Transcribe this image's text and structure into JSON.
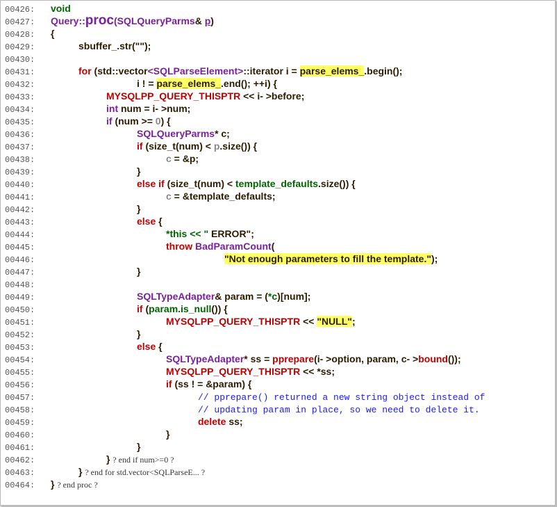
{
  "colors": {
    "keyword": "#006400",
    "type": "#7a1f9e",
    "macro": "#c00000",
    "string": "#000000",
    "comment": "#1a1aff",
    "plain": "#2b1b00",
    "number": "#888888",
    "highlight": "#ffff66"
  },
  "lines": [
    {
      "no": "00426:",
      "indent": 0,
      "parts": [
        [
          "kw",
          "void"
        ]
      ]
    },
    {
      "no": "00427:",
      "indent": 0,
      "parts": [
        [
          "ty",
          "Query::"
        ],
        [
          "fn",
          "proc"
        ],
        [
          "ty",
          "(SQLQueryParms"
        ],
        [
          "pl",
          "& "
        ],
        [
          "ul",
          "p"
        ],
        [
          "pl",
          ")"
        ]
      ]
    },
    {
      "no": "00428:",
      "indent": 0,
      "parts": [
        [
          "pl",
          "{"
        ]
      ]
    },
    {
      "no": "00429:",
      "indent": 1,
      "parts": [
        [
          "pl",
          "sbuffer_.str(\"\");"
        ]
      ]
    },
    {
      "no": "00430:",
      "indent": 0,
      "parts": []
    },
    {
      "no": "00431:",
      "indent": 1,
      "parts": [
        [
          "mc",
          "for"
        ],
        [
          "pl",
          " (std::vector"
        ],
        [
          "ty",
          "<SQLParseElement>"
        ],
        [
          "pl",
          "::iterator i = "
        ],
        [
          "hl",
          "parse_elems_"
        ],
        [
          "pl",
          ".begin();"
        ]
      ]
    },
    {
      "no": "00432:",
      "indent": 3,
      "parts": [
        [
          "pl",
          "i ! = "
        ],
        [
          "hl",
          "parse_elems_"
        ],
        [
          "pl",
          ".end(); ++i) {"
        ]
      ]
    },
    {
      "no": "00433:",
      "indent": 2,
      "parts": [
        [
          "mc",
          "MYSQLPP_QUERY_THISPTR"
        ],
        [
          "pl",
          " << i- >before;"
        ]
      ]
    },
    {
      "no": "00434:",
      "indent": 2,
      "parts": [
        [
          "ty",
          "int"
        ],
        [
          "pl",
          " num = i- >num;"
        ]
      ]
    },
    {
      "no": "00435:",
      "indent": 2,
      "parts": [
        [
          "ty",
          "if"
        ],
        [
          "pl",
          " (num >= "
        ],
        [
          "nm",
          "0"
        ],
        [
          "pl",
          ") {"
        ]
      ]
    },
    {
      "no": "00436:",
      "indent": 3,
      "parts": [
        [
          "ty",
          "SQLQueryParms"
        ],
        [
          "pl",
          "* c;"
        ]
      ]
    },
    {
      "no": "00437:",
      "indent": 3,
      "parts": [
        [
          "mc",
          "if"
        ],
        [
          "pl",
          " (size_t(num) < "
        ],
        [
          "nm",
          "p"
        ],
        [
          "pl",
          ".size()) {"
        ]
      ]
    },
    {
      "no": "00438:",
      "indent": 4,
      "parts": [
        [
          "nm",
          "c"
        ],
        [
          "pl",
          " = &p;"
        ]
      ]
    },
    {
      "no": "00439:",
      "indent": 3,
      "parts": [
        [
          "pl",
          "}"
        ]
      ]
    },
    {
      "no": "00440:",
      "indent": 3,
      "parts": [
        [
          "mc",
          "else if"
        ],
        [
          "pl",
          " (size_t(num) < "
        ],
        [
          "kw",
          "template_defaults"
        ],
        [
          "pl",
          ".size()) {"
        ]
      ]
    },
    {
      "no": "00441:",
      "indent": 4,
      "parts": [
        [
          "nm",
          "c"
        ],
        [
          "pl",
          " = &template_defaults;"
        ]
      ]
    },
    {
      "no": "00442:",
      "indent": 3,
      "parts": [
        [
          "pl",
          "}"
        ]
      ]
    },
    {
      "no": "00443:",
      "indent": 3,
      "parts": [
        [
          "mc",
          "else"
        ],
        [
          "pl",
          " {"
        ]
      ]
    },
    {
      "no": "00444:",
      "indent": 4,
      "parts": [
        [
          "kw",
          "*this << \""
        ],
        [
          "pl",
          " ERROR\";"
        ]
      ]
    },
    {
      "no": "00445:",
      "indent": 4,
      "parts": [
        [
          "mc",
          "throw"
        ],
        [
          "pl",
          " "
        ],
        [
          "ty",
          "BadParamCount"
        ],
        [
          "pl",
          "("
        ]
      ]
    },
    {
      "no": "00446:",
      "indent": 6,
      "parts": [
        [
          "hl",
          "\"Not enough parameters to fill the template.\""
        ],
        [
          "pl",
          ");"
        ]
      ]
    },
    {
      "no": "00447:",
      "indent": 3,
      "parts": [
        [
          "pl",
          "}"
        ]
      ]
    },
    {
      "no": "00448:",
      "indent": 0,
      "parts": []
    },
    {
      "no": "00449:",
      "indent": 3,
      "parts": [
        [
          "ty",
          "SQLTypeAdapter"
        ],
        [
          "pl",
          "& param = ("
        ],
        [
          "kw",
          "*c"
        ],
        [
          "pl",
          ")[num];"
        ]
      ]
    },
    {
      "no": "00450:",
      "indent": 3,
      "parts": [
        [
          "mc",
          "if"
        ],
        [
          "pl",
          " ("
        ],
        [
          "kw",
          "param.is_null"
        ],
        [
          "pl",
          "()) {"
        ]
      ]
    },
    {
      "no": "00451:",
      "indent": 4,
      "parts": [
        [
          "mc",
          "MYSQLPP_QUERY_THISPTR"
        ],
        [
          "pl",
          " << "
        ],
        [
          "hl",
          "\"NULL\""
        ],
        [
          "pl",
          ";"
        ]
      ]
    },
    {
      "no": "00452:",
      "indent": 3,
      "parts": [
        [
          "pl",
          "}"
        ]
      ]
    },
    {
      "no": "00453:",
      "indent": 3,
      "parts": [
        [
          "mc",
          "else"
        ],
        [
          "pl",
          " {"
        ]
      ]
    },
    {
      "no": "00454:",
      "indent": 4,
      "parts": [
        [
          "ty",
          "SQLTypeAdapter"
        ],
        [
          "pl",
          "* ss = "
        ],
        [
          "mc",
          "pprepare"
        ],
        [
          "pl",
          "(i- >option, param, c- >"
        ],
        [
          "mc",
          "bound"
        ],
        [
          "pl",
          "());"
        ]
      ]
    },
    {
      "no": "00455:",
      "indent": 4,
      "parts": [
        [
          "mc",
          "MYSQLPP_QUERY_THISPTR"
        ],
        [
          "pl",
          " << *ss;"
        ]
      ]
    },
    {
      "no": "00456:",
      "indent": 4,
      "parts": [
        [
          "mc",
          "if"
        ],
        [
          "pl",
          " (ss ! = &param) {"
        ]
      ]
    },
    {
      "no": "00457:",
      "indent": 5,
      "parts": [
        [
          "cm",
          "// pprepare() returned a new string object instead of"
        ]
      ]
    },
    {
      "no": "00458:",
      "indent": 5,
      "parts": [
        [
          "cm",
          "// updating param in place, so we need to delete it."
        ]
      ]
    },
    {
      "no": "00459:",
      "indent": 5,
      "parts": [
        [
          "mc",
          "delete"
        ],
        [
          "pl",
          " ss;"
        ]
      ]
    },
    {
      "no": "00460:",
      "indent": 4,
      "parts": [
        [
          "pl",
          "}"
        ]
      ]
    },
    {
      "no": "00461:",
      "indent": 3,
      "parts": [
        [
          "pl",
          "}"
        ]
      ]
    },
    {
      "no": "00462:",
      "indent": 2,
      "parts": [
        [
          "pl",
          "} "
        ],
        [
          "cs",
          "? end if num>=0 ?"
        ]
      ]
    },
    {
      "no": "00463:",
      "indent": 1,
      "parts": [
        [
          "pl",
          "} "
        ],
        [
          "cs",
          "? end for std.vector<SQLParseE... ?"
        ]
      ]
    },
    {
      "no": "00464:",
      "indent": 0,
      "parts": [
        [
          "pl",
          "} "
        ],
        [
          "cs",
          "? end proc ?"
        ]
      ]
    }
  ]
}
